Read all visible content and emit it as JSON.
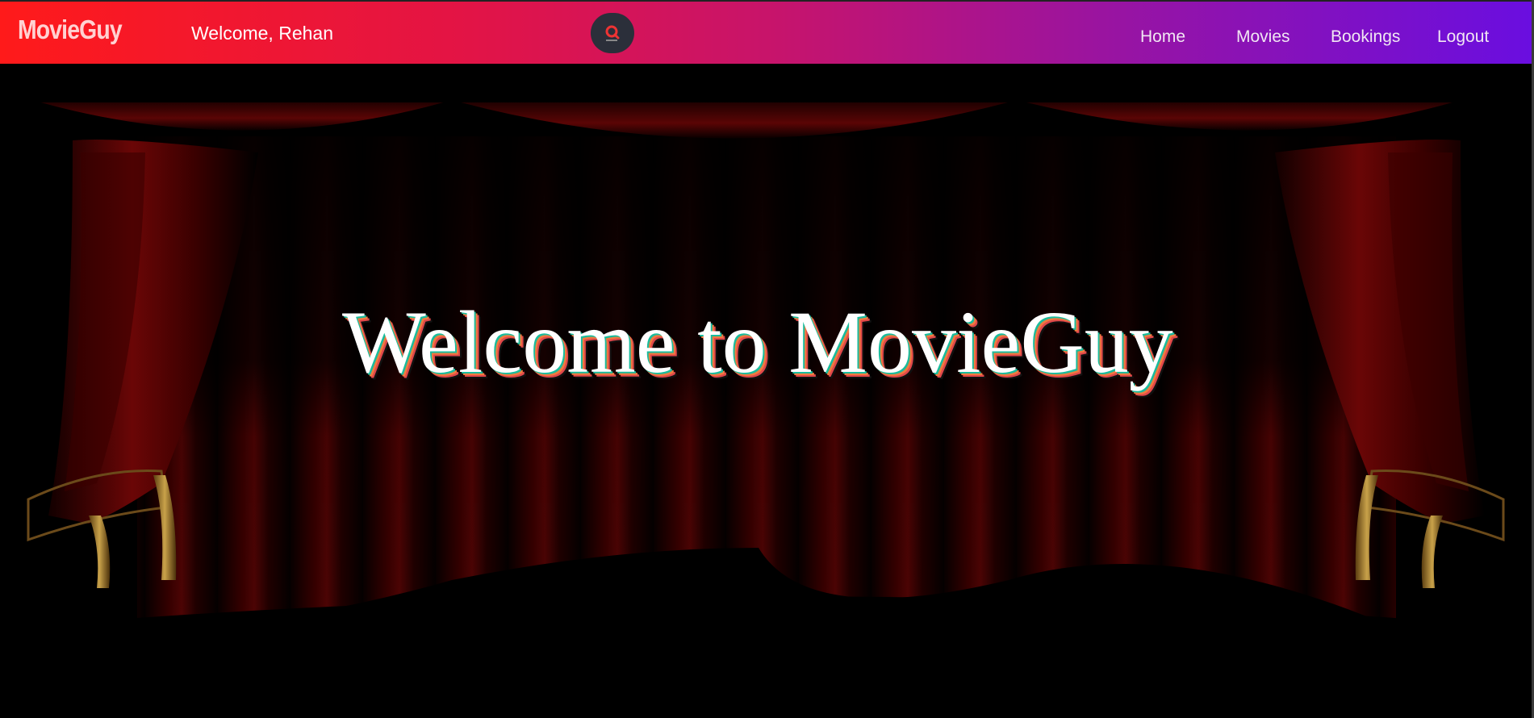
{
  "navbar": {
    "brand": "MovieGuy",
    "welcome": "Welcome, Rehan",
    "search_icon": "search-icon",
    "links": [
      {
        "label": "Home"
      },
      {
        "label": "Movies"
      },
      {
        "label": "Bookings"
      },
      {
        "label": "Logout"
      }
    ],
    "gradient": [
      "#ff1a1a",
      "#c8146a",
      "#6a0ee0"
    ]
  },
  "hero": {
    "title": "Welcome to MovieGuy",
    "background": "theater-curtain-image"
  }
}
